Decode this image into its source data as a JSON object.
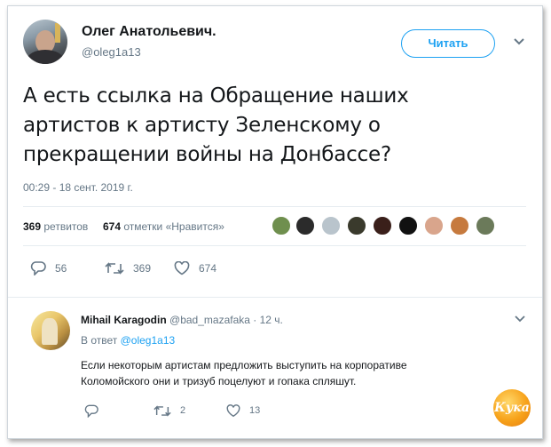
{
  "tweet": {
    "author_name": "Олег Анатольевич.",
    "author_handle": "@oleg1a13",
    "follow_label": "Читать",
    "text_lines": [
      "А есть ссылка на Обращение наших",
      "артистов к артисту Зеленскому о",
      "прекращении войны на Донбассе?"
    ],
    "timestamp": "00:29 - 18 сент. 2019 г.",
    "retweets_count": "369",
    "retweets_label": "ретвитов",
    "likes_count": "674",
    "likes_label": "отметки «Нравится»",
    "likers_icon": "liker-avatars",
    "actions": {
      "replies": "56",
      "retweets": "369",
      "likes": "674"
    }
  },
  "reply": {
    "author_name": "Mihail Karagodin",
    "author_handle": "@bad_mazafaka",
    "time": "· 12 ч.",
    "reply_prefix": "В ответ",
    "reply_mention": "@oleg1a13",
    "text_lines": [
      "Если некоторым артистам предложить выступить на корпоративе",
      "Коломойского они и тризуб поцелуют и гопака спляшут."
    ],
    "actions": {
      "replies": "",
      "retweets": "2",
      "likes": "13"
    }
  },
  "watermark": "Кука",
  "colors": {
    "accent": "#1da1f2",
    "secondary_text": "#657786",
    "primary_text": "#14171a",
    "divider": "#e6ecf0"
  }
}
